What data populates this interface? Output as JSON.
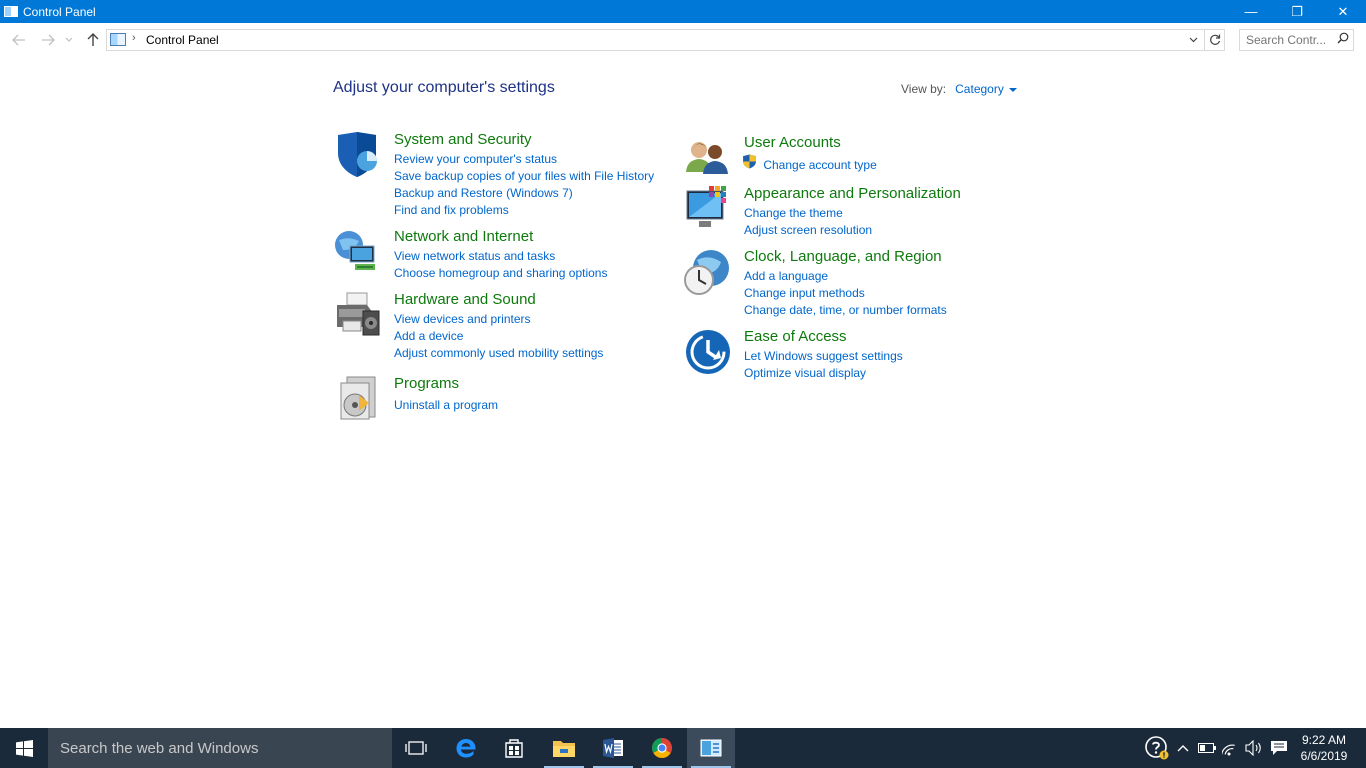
{
  "window": {
    "title": "Control Panel",
    "caption": {
      "minimize": "—",
      "restore": "❐",
      "close": "✕"
    }
  },
  "address": {
    "breadcrumb": "Control Panel",
    "separator": "›",
    "search_placeholder": "Search Contr..."
  },
  "header": {
    "title": "Adjust your computer's settings",
    "view_by_label": "View by:",
    "view_by_value": "Category"
  },
  "categories": [
    {
      "title": "System and Security",
      "links": [
        "Review your computer's status",
        "Save backup copies of your files with File History",
        "Backup and Restore (Windows 7)",
        "Find and fix problems"
      ]
    },
    {
      "title": "Network and Internet",
      "links": [
        "View network status and tasks",
        "Choose homegroup and sharing options"
      ]
    },
    {
      "title": "Hardware and Sound",
      "links": [
        "View devices and printers",
        "Add a device",
        "Adjust commonly used mobility settings"
      ]
    },
    {
      "title": "Programs",
      "links": [
        "Uninstall a program"
      ]
    },
    {
      "title": "User Accounts",
      "links": [
        "Change account type"
      ]
    },
    {
      "title": "Appearance and Personalization",
      "links": [
        "Change the theme",
        "Adjust screen resolution"
      ]
    },
    {
      "title": "Clock, Language, and Region",
      "links": [
        "Add a language",
        "Change input methods",
        "Change date, time, or number formats"
      ]
    },
    {
      "title": "Ease of Access",
      "links": [
        "Let Windows suggest settings",
        "Optimize visual display"
      ]
    }
  ],
  "taskbar": {
    "search_text": "Search the web and Windows",
    "apps": [
      "task-view",
      "edge",
      "store",
      "file-explorer",
      "word",
      "chrome",
      "control-panel"
    ],
    "time": "9:22 AM",
    "date": "6/6/2019"
  },
  "colors": {
    "titlebar": "#0078d7",
    "category_title": "#0e7a0d",
    "link": "#0066cc",
    "page_title": "#1e3287",
    "taskbar": "#1b2a3a"
  }
}
